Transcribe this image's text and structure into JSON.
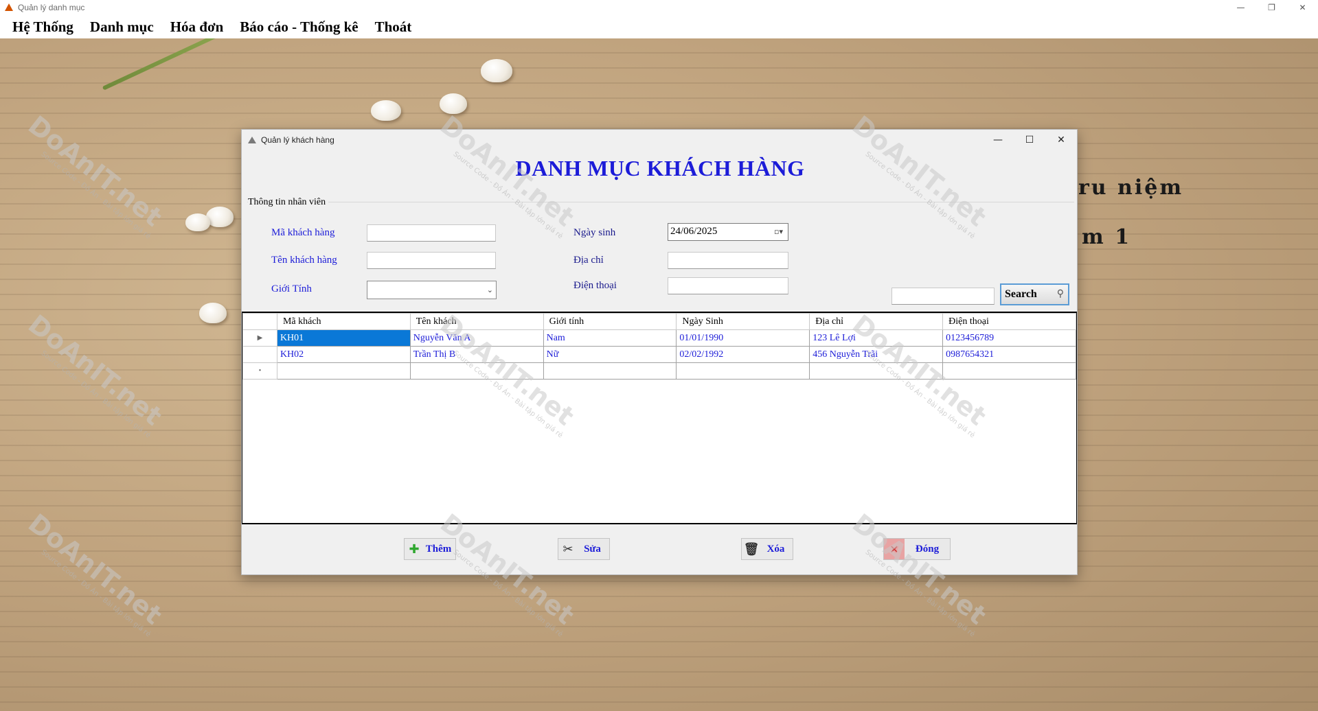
{
  "app": {
    "title": "Quản lý danh mục",
    "controls": {
      "minimize": "—",
      "maximize": "❐",
      "close": "✕"
    }
  },
  "menu": [
    "Hệ Thống",
    "Danh mục",
    "Hóa đơn",
    "Báo cáo - Thống kê",
    "Thoát"
  ],
  "background": {
    "text_line1": "ru niệm",
    "text_line2": "m 1"
  },
  "watermark": {
    "brand": "DoAnIT.net",
    "tagline": "Source Code - Đồ Án - Bài tập lớn giá rẻ"
  },
  "dialog": {
    "title": "Quản lý khách hàng",
    "controls": {
      "minimize": "—",
      "maximize": "☐",
      "close": "✕"
    },
    "heading": "DANH MỤC KHÁCH HÀNG",
    "group_title": "Thông tin nhân viên",
    "form": {
      "ma_kh_label": "Mã khách hàng",
      "ten_kh_label": "Tên khách hàng",
      "gioi_tinh_label": "Giới Tính",
      "ngay_sinh_label": "Ngày sinh",
      "dia_chi_label": "Địa chỉ",
      "dien_thoai_label": "Điện thoại",
      "ma_kh_value": "",
      "ten_kh_value": "",
      "gioi_tinh_value": "",
      "ngay_sinh_value": "24/06/2025",
      "dia_chi_value": "",
      "dien_thoai_value": "",
      "search_value": ""
    },
    "search_label": "Search",
    "grid": {
      "columns": [
        "Mã khách",
        "Tên khách",
        "Giới tính",
        "Ngày Sinh",
        "Địa chỉ",
        "Điện thoại"
      ],
      "rows": [
        [
          "KH01",
          "Nguyễn Văn A",
          "Nam",
          "01/01/1990",
          "123 Lê Lợi",
          "0123456789"
        ],
        [
          "KH02",
          "Trần Thị B",
          "Nữ",
          "02/02/1992",
          "456 Nguyễn Trãi",
          "0987654321"
        ]
      ],
      "current_row_marker": "▶",
      "new_row_marker": "•"
    },
    "buttons": {
      "add": "Thêm",
      "edit": "Sửa",
      "delete": "Xóa",
      "close": "Đóng"
    }
  },
  "colors": {
    "accent_blue": "#1c1cd8",
    "selection": "#0a78d7",
    "close_button": "#e8a3a3"
  }
}
